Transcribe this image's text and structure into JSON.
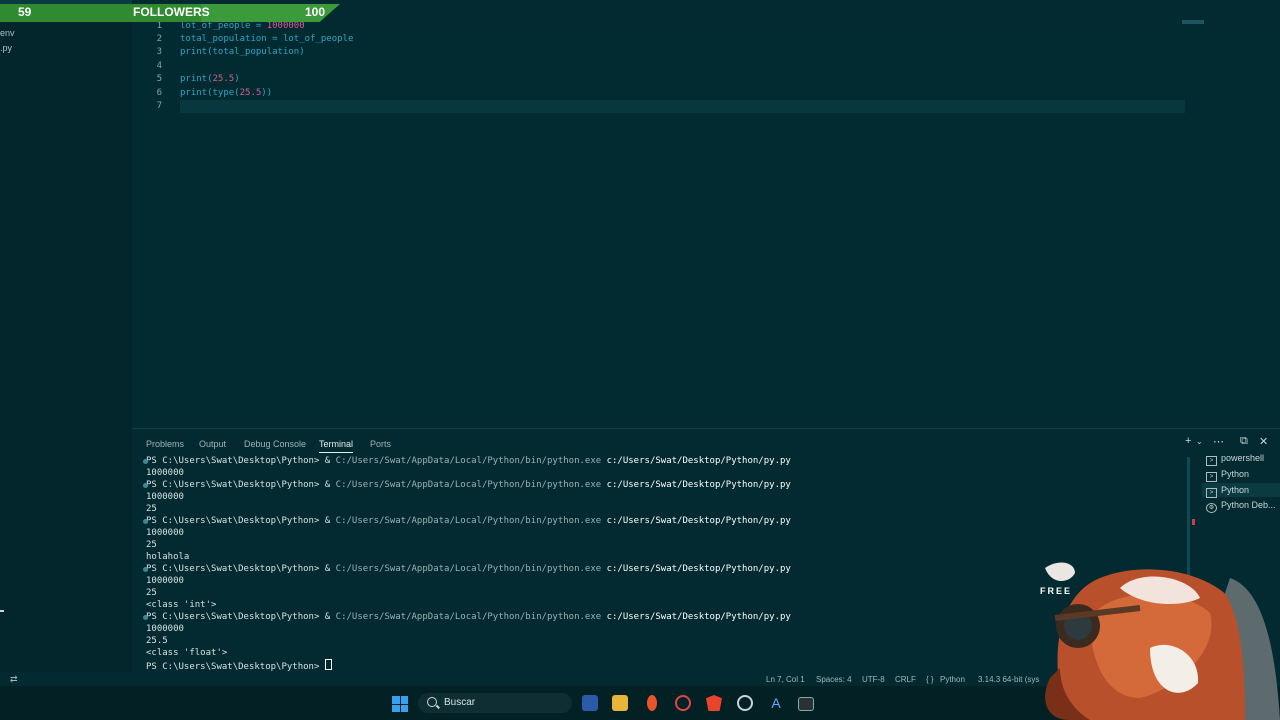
{
  "followers": {
    "current": "59",
    "label": "FOLLOWERS",
    "goal": "100",
    "progress": 0.59
  },
  "explorer": {
    "items": [
      "env",
      ".py"
    ]
  },
  "editor": {
    "lines": [
      {
        "n": "1",
        "t": "lot_of_people = 1000000"
      },
      {
        "n": "2",
        "t": "total_population = lot_of_people"
      },
      {
        "n": "3",
        "t": "print(total_population)"
      },
      {
        "n": "4",
        "t": ""
      },
      {
        "n": "5",
        "t": "print(25.5)"
      },
      {
        "n": "6",
        "t": "print(type(25.5))"
      },
      {
        "n": "7",
        "t": ""
      }
    ]
  },
  "panel": {
    "tabs": [
      "Problems",
      "Output",
      "Debug Console",
      "Terminal",
      "Ports"
    ],
    "active_tab": "Terminal"
  },
  "terminal": {
    "prompt": "PS C:\\Users\\Swat\\Desktop\\Python> & ",
    "exe": "C:/Users/Swat/AppData/Local/Python/bin/python.exe",
    "script": "c:/Users/Swat/Desktop/Python/py.py",
    "outputs": [
      [
        "1000000"
      ],
      [
        "1000000",
        "25"
      ],
      [
        "1000000",
        "25",
        "holahola"
      ],
      [
        "1000000",
        "25",
        "<class 'int'>"
      ],
      [
        "1000000",
        "25.5",
        "<class 'float'>"
      ]
    ],
    "final_prompt": "PS C:\\Users\\Swat\\Desktop\\Python> ",
    "instances": [
      "powershell",
      "Python",
      "Python",
      "Python Deb..."
    ]
  },
  "status": {
    "position": "Ln 7, Col 1",
    "spaces": "Spaces: 4",
    "encoding": "UTF-8",
    "eol": "CRLF",
    "lang_icon": "{ }",
    "language": "Python",
    "interpreter": "3.14.3 64-bit (sys"
  },
  "taskbar": {
    "search_placeholder": "Buscar"
  },
  "overlay": {
    "free_text": "FREE"
  }
}
